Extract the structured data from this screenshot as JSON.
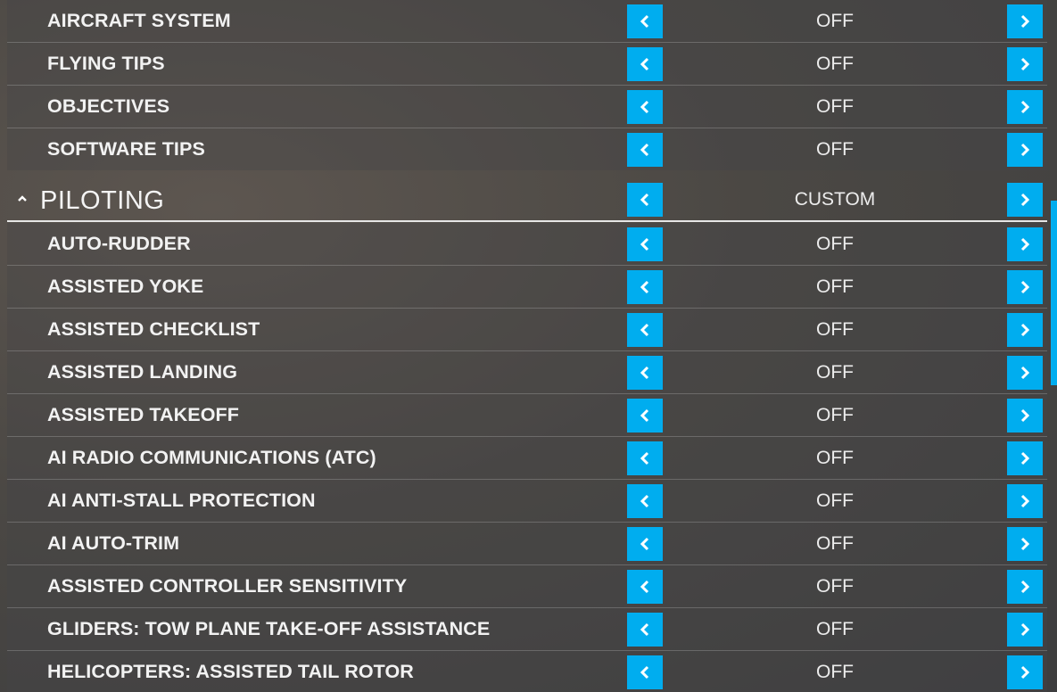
{
  "colors": {
    "accent": "#00adef",
    "text": "#f2f2f2"
  },
  "icons": {
    "left": "chevron-left-icon",
    "right": "chevron-right-icon",
    "collapse": "caret-up-icon"
  },
  "notifications_group": {
    "rows": [
      {
        "label": "AIRCRAFT SYSTEM",
        "value": "OFF"
      },
      {
        "label": "FLYING TIPS",
        "value": "OFF"
      },
      {
        "label": "OBJECTIVES",
        "value": "OFF"
      },
      {
        "label": "SOFTWARE TIPS",
        "value": "OFF"
      }
    ]
  },
  "piloting": {
    "title": "PILOTING",
    "value": "CUSTOM",
    "rows": [
      {
        "label": "AUTO-RUDDER",
        "value": "OFF"
      },
      {
        "label": "ASSISTED YOKE",
        "value": "OFF"
      },
      {
        "label": "ASSISTED CHECKLIST",
        "value": "OFF"
      },
      {
        "label": "ASSISTED LANDING",
        "value": "OFF"
      },
      {
        "label": "ASSISTED TAKEOFF",
        "value": "OFF"
      },
      {
        "label": "AI RADIO COMMUNICATIONS (ATC)",
        "value": "OFF"
      },
      {
        "label": "AI ANTI-STALL PROTECTION",
        "value": "OFF"
      },
      {
        "label": "AI AUTO-TRIM",
        "value": "OFF"
      },
      {
        "label": "ASSISTED CONTROLLER SENSITIVITY",
        "value": "OFF"
      },
      {
        "label": "GLIDERS: TOW PLANE TAKE-OFF ASSISTANCE",
        "value": "OFF"
      },
      {
        "label": "HELICOPTERS: ASSISTED TAIL ROTOR",
        "value": "OFF"
      }
    ]
  }
}
